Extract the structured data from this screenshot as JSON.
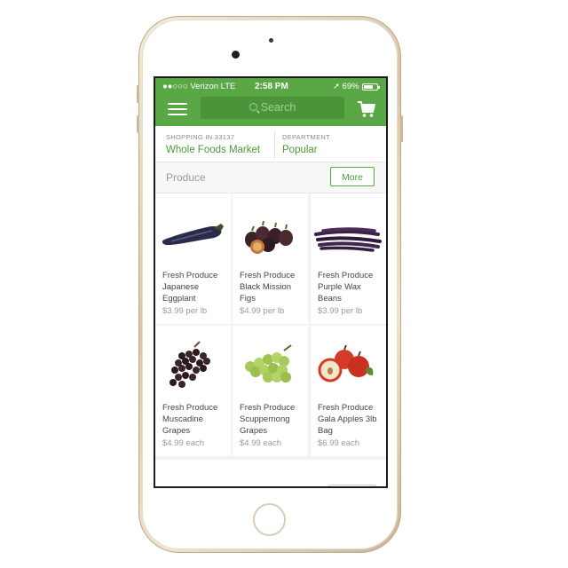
{
  "status_bar": {
    "carrier": "●●○○○ Verizon  LTE",
    "time": "2:58 PM",
    "battery": "69%"
  },
  "header": {
    "search_placeholder": "Search"
  },
  "context": {
    "shopping_caption": "SHOPPING IN 33137",
    "store": "Whole Foods Market",
    "department_caption": "DEPARTMENT",
    "department": "Popular"
  },
  "category": {
    "label": "Produce",
    "more_label": "More"
  },
  "products": [
    {
      "name": "Fresh Produce Japanese Eggplant",
      "price": "$3.99 per lb",
      "image": "eggplant"
    },
    {
      "name": "Fresh Produce Black Mission Figs",
      "price": "$4.99 per lb",
      "image": "figs"
    },
    {
      "name": "Fresh Produce Purple Wax Beans",
      "price": "$3.99 per lb",
      "image": "purple-beans"
    },
    {
      "name": "Fresh Produce Muscadine Grapes",
      "price": "$4.99 each",
      "image": "muscadine-grapes"
    },
    {
      "name": "Fresh Produce Scuppernong Grapes",
      "price": "$4.99 each",
      "image": "green-grapes"
    },
    {
      "name": "Fresh Produce Gala Apples 3lb Bag",
      "price": "$6.99 each",
      "image": "apples"
    }
  ],
  "colors": {
    "brand_green": "#5aa845",
    "link_green": "#4d9a3a"
  }
}
